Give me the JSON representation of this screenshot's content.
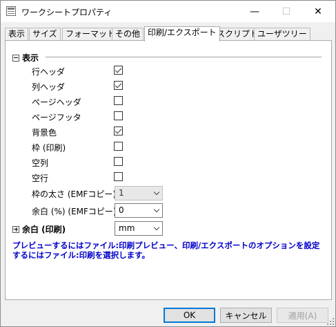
{
  "window": {
    "title": "ワークシートプロパティ",
    "min_glyph": "—",
    "max_glyph": "☐",
    "close_glyph": "✕"
  },
  "tabs": [
    {
      "label": "表示",
      "active": false
    },
    {
      "label": "サイズ",
      "active": false
    },
    {
      "label": "フォーマット",
      "active": false
    },
    {
      "label": "その他",
      "active": false
    },
    {
      "label": "印刷/エクスポート",
      "active": true
    },
    {
      "label": "スクリプト",
      "active": false
    },
    {
      "label": "ユーザツリー",
      "active": false
    }
  ],
  "group_display": {
    "title": "表示",
    "expanded": true,
    "items": [
      {
        "label": "行ヘッダ",
        "checked": true
      },
      {
        "label": "列ヘッダ",
        "checked": true
      },
      {
        "label": "ページヘッダ",
        "checked": false
      },
      {
        "label": "ページフッタ",
        "checked": false
      },
      {
        "label": "背景色",
        "checked": true
      },
      {
        "label": "枠 (印刷)",
        "checked": false
      },
      {
        "label": "空列",
        "checked": false
      },
      {
        "label": "空行",
        "checked": false
      }
    ],
    "border_width": {
      "label": "枠の太さ (EMFコピー)",
      "value": "1",
      "enabled": false
    },
    "margin_pct": {
      "label": "余白 (%) (EMFコピー)",
      "value": "0",
      "enabled": true
    }
  },
  "group_margin": {
    "title": "余白 (印刷)",
    "expanded": false,
    "unit_value": "mm"
  },
  "note_text": "プレビューするにはファイル:印刷プレビュー、印刷/エクスポートのオプションを設定するにはファイル:印刷を選択します。",
  "buttons": {
    "ok": "OK",
    "cancel": "キャンセル",
    "apply": "適用(A)"
  },
  "colors": {
    "note": "#0000cc",
    "default_button_border": "#0078d7"
  }
}
